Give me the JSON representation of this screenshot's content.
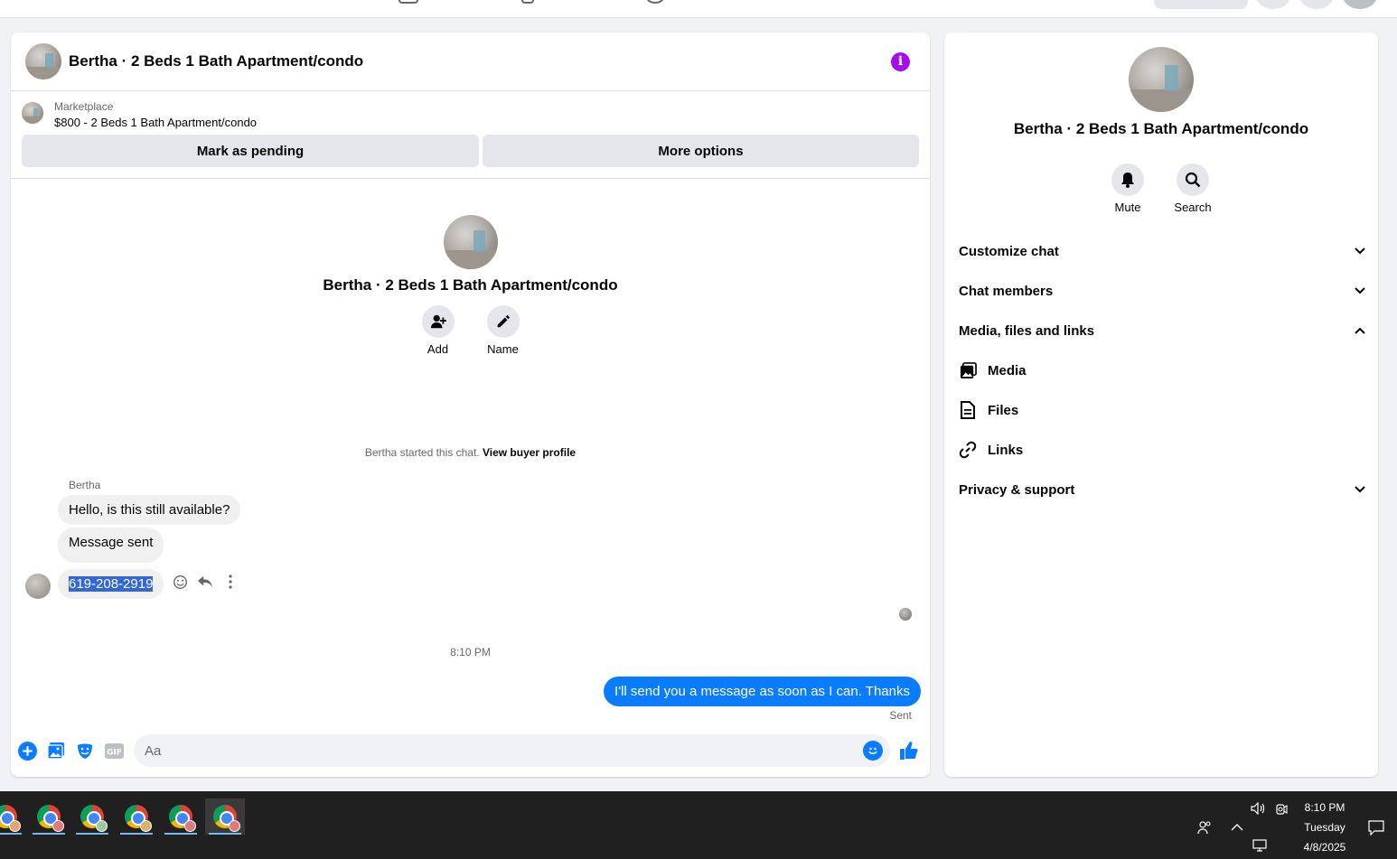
{
  "chat": {
    "title": "Bertha · 2 Beds 1 Bath Apartment/condo",
    "listing": {
      "source": "Marketplace",
      "price_title": "$800 - 2 Beds 1 Bath Apartment/condo",
      "mark_pending_label": "Mark as pending",
      "more_options_label": "More options"
    },
    "profile": {
      "name": "Bertha · 2 Beds 1 Bath Apartment/condo",
      "add_label": "Add",
      "name_label": "Name"
    },
    "started_text": "Bertha started this chat.",
    "view_buyer_label": "View buyer profile",
    "sender": "Bertha",
    "messages_in": [
      "Hello, is this still available?",
      "Message sent",
      "619-208-2919"
    ],
    "timestamp": "8:10 PM",
    "message_out": "I'll send you a message as soon as I can. Thanks",
    "sent_status": "Sent",
    "composer_placeholder": "Aa"
  },
  "panel": {
    "name": "Bertha · 2 Beds 1 Bath Apartment/condo",
    "mute_label": "Mute",
    "search_label": "Search",
    "sections": {
      "customize": "Customize chat",
      "members": "Chat members",
      "media_files_links": "Media, files and links",
      "media": "Media",
      "files": "Files",
      "links": "Links",
      "privacy": "Privacy & support"
    }
  },
  "taskbar": {
    "time": "8:10 PM",
    "day": "Tuesday",
    "date": "4/8/2025"
  },
  "colors": {
    "accent": "#0a7cff",
    "info": "#a30fe6",
    "selection": "#3367d6"
  }
}
